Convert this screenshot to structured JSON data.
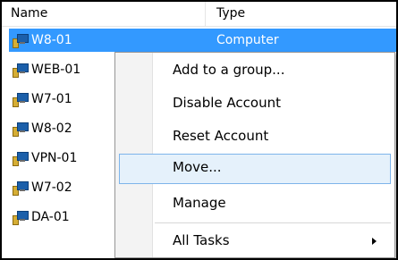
{
  "columns": {
    "name": "Name",
    "type": "Type"
  },
  "rows": [
    {
      "name": "W8-01",
      "type": "Computer",
      "selected": true
    },
    {
      "name": "WEB-01",
      "type": ""
    },
    {
      "name": "W7-01",
      "type": ""
    },
    {
      "name": "W8-02",
      "type": ""
    },
    {
      "name": "VPN-01",
      "type": ""
    },
    {
      "name": "W7-02",
      "type": ""
    },
    {
      "name": "DA-01",
      "type": ""
    }
  ],
  "menu": {
    "items": [
      {
        "label": "Add to a group..."
      },
      {
        "label": "Disable Account"
      },
      {
        "label": "Reset Account"
      },
      {
        "label": "Move...",
        "highlighted": true
      },
      {
        "label": "Manage"
      },
      {
        "label": "All Tasks",
        "submenu": true
      }
    ]
  },
  "colors": {
    "selection": "#3399ff",
    "menu_hover": "#e5f1fb",
    "menu_hover_border": "#7eb4ea"
  },
  "icons": {
    "row_icon": "computer-icon",
    "submenu": "chevron-right-icon"
  }
}
